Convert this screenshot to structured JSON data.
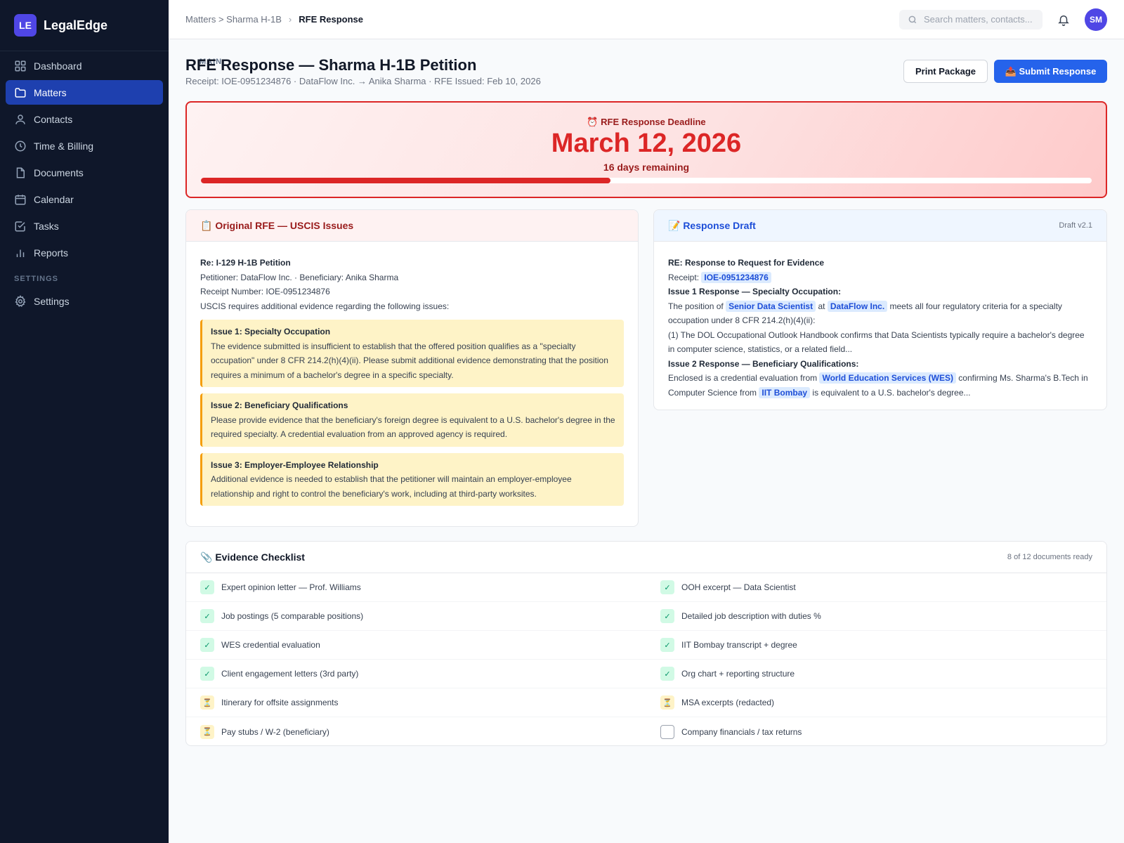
{
  "brand": {
    "logo": "LE",
    "name": "LegalEdge"
  },
  "nav": {
    "main_label": "MAIN",
    "settings_label": "SETTINGS",
    "items": [
      {
        "label": "Dashboard",
        "icon": "grid-icon"
      },
      {
        "label": "Matters",
        "icon": "folder-icon",
        "active": true
      },
      {
        "label": "Contacts",
        "icon": "user-icon"
      },
      {
        "label": "Time & Billing",
        "icon": "clock-icon"
      },
      {
        "label": "Documents",
        "icon": "document-icon"
      },
      {
        "label": "Calendar",
        "icon": "calendar-icon"
      },
      {
        "label": "Tasks",
        "icon": "checkbox-icon"
      },
      {
        "label": "Reports",
        "icon": "bar-chart-icon"
      }
    ],
    "settings_item": {
      "label": "Settings",
      "icon": "gear-icon"
    }
  },
  "topbar": {
    "breadcrumb_parent": "Matters > Sharma H-1B",
    "breadcrumb_current": "RFE Response",
    "search_placeholder": "Search matters, contacts...",
    "avatar": "SM"
  },
  "header": {
    "title": "RFE Response — Sharma H-1B Petition",
    "subtitle": "Receipt: IOE-0951234876 · DataFlow Inc. → Anika Sharma · RFE Issued: Feb 10, 2026",
    "print_label": "Print Package",
    "submit_label": "📤 Submit Response"
  },
  "deadline": {
    "label": "⏰ RFE Response Deadline",
    "date": "March 12, 2026",
    "remaining": "16 days remaining",
    "progress_percent": 46,
    "color": "#dc2626"
  },
  "rfe": {
    "title": "📋 Original RFE — USCIS Issues",
    "re": "Re: I-129 H-1B Petition",
    "parties": "Petitioner: DataFlow Inc. · Beneficiary: Anika Sharma",
    "receipt": "Receipt Number: IOE-0951234876",
    "intro": "USCIS requires additional evidence regarding the following issues:",
    "issues": [
      {
        "title": "Issue 1: Specialty Occupation",
        "text": "The evidence submitted is insufficient to establish that the offered position qualifies as a \"specialty occupation\" under 8 CFR 214.2(h)(4)(ii). Please submit additional evidence demonstrating that the position requires a minimum of a bachelor's degree in a specific specialty."
      },
      {
        "title": "Issue 2: Beneficiary Qualifications",
        "text": "Please provide evidence that the beneficiary's foreign degree is equivalent to a U.S. bachelor's degree in the required specialty. A credential evaluation from an approved agency is required."
      },
      {
        "title": "Issue 3: Employer-Employee Relationship",
        "text": "Additional evidence is needed to establish that the petitioner will maintain an employer-employee relationship and right to control the beneficiary's work, including at third-party worksites."
      }
    ]
  },
  "draft": {
    "title": "📝 Response Draft",
    "version": "Draft v2.1",
    "re": "RE: Response to Request for Evidence",
    "receipt_label": "Receipt:",
    "receipt_value": "IOE-0951234876",
    "issue1_heading": "Issue 1 Response — Specialty Occupation:",
    "issue1_a": "The position of",
    "issue1_role": "Senior Data Scientist",
    "issue1_b": "at",
    "issue1_company": "DataFlow Inc.",
    "issue1_c": "meets all four regulatory criteria for a specialty occupation under 8 CFR 214.2(h)(4)(ii):",
    "issue1_point": "(1) The DOL Occupational Outlook Handbook confirms that Data Scientists typically require a bachelor's degree in computer science, statistics, or a related field...",
    "issue2_heading": "Issue 2 Response — Beneficiary Qualifications:",
    "issue2_a": "Enclosed is a credential evaluation from",
    "issue2_agency": "World Education Services (WES)",
    "issue2_b": "confirming Ms. Sharma's B.Tech in Computer Science from",
    "issue2_school": "IIT Bombay",
    "issue2_c": "is equivalent to a U.S. bachelor's degree..."
  },
  "checklist": {
    "title": "📎 Evidence Checklist",
    "summary": "8 of 12 documents ready",
    "items": [
      {
        "label": "Expert opinion letter — Prof. Williams",
        "status": "done"
      },
      {
        "label": "OOH excerpt — Data Scientist",
        "status": "done"
      },
      {
        "label": "Job postings (5 comparable positions)",
        "status": "done"
      },
      {
        "label": "Detailed job description with duties %",
        "status": "done"
      },
      {
        "label": "WES credential evaluation",
        "status": "done"
      },
      {
        "label": "IIT Bombay transcript + degree",
        "status": "done"
      },
      {
        "label": "Client engagement letters (3rd party)",
        "status": "done"
      },
      {
        "label": "Org chart + reporting structure",
        "status": "done"
      },
      {
        "label": "Itinerary for offsite assignments",
        "status": "pending"
      },
      {
        "label": "MSA excerpts (redacted)",
        "status": "pending"
      },
      {
        "label": "Pay stubs / W-2 (beneficiary)",
        "status": "pending"
      },
      {
        "label": "Company financials / tax returns",
        "status": "empty"
      }
    ],
    "status_glyphs": {
      "done": "✓",
      "pending": "⏳",
      "empty": ""
    }
  }
}
